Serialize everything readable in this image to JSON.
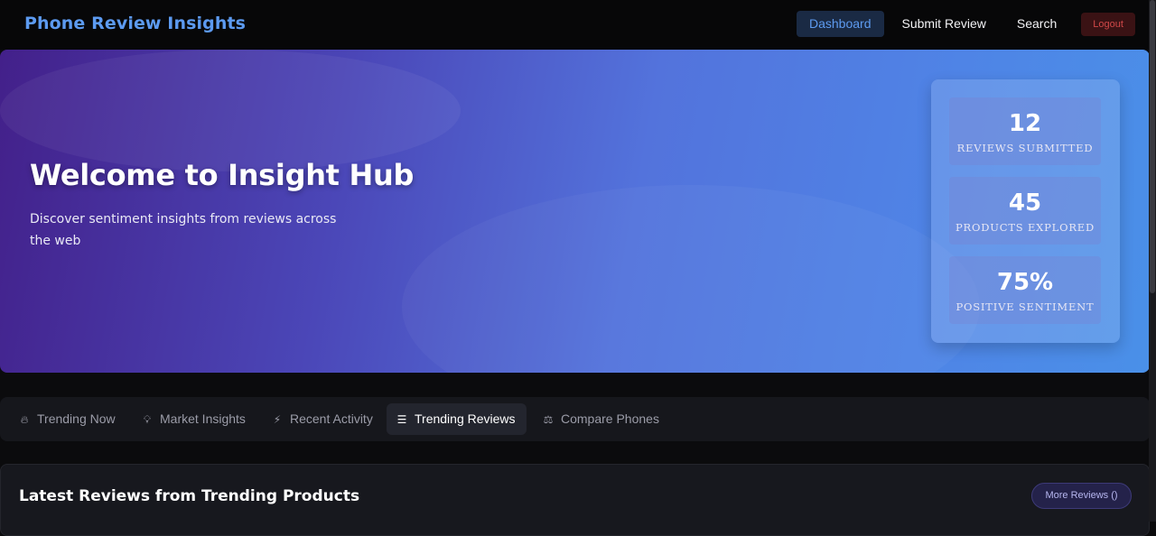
{
  "header": {
    "brand": "Phone Review Insights",
    "nav": {
      "dashboard": "Dashboard",
      "submit_review": "Submit Review",
      "search": "Search",
      "logout": "Logout"
    }
  },
  "hero": {
    "title": "Welcome to Insight Hub",
    "subtitle": "Discover sentiment insights from reviews across the web",
    "stats": [
      {
        "value": "12",
        "label": "REVIEWS SUBMITTED"
      },
      {
        "value": "45",
        "label": "PRODUCTS EXPLORED"
      },
      {
        "value": "75%",
        "label": "POSITIVE SENTIMENT"
      }
    ]
  },
  "tabs": [
    {
      "label": "Trending Now",
      "icon": "fire-icon",
      "glyph": "🔥︎"
    },
    {
      "label": "Market Insights",
      "icon": "lightbulb-icon",
      "glyph": "💡︎"
    },
    {
      "label": "Recent Activity",
      "icon": "bolt-icon",
      "glyph": "⚡︎"
    },
    {
      "label": "Trending Reviews",
      "icon": "list-icon",
      "glyph": "☰",
      "active": true
    },
    {
      "label": "Compare Phones",
      "icon": "scale-icon",
      "glyph": "⚖︎"
    }
  ],
  "section": {
    "title": "Latest Reviews from Trending Products",
    "more_button": "More Reviews ()"
  },
  "colors": {
    "brand": "#5c9af0",
    "nav_active_bg": "#1a2a44",
    "logout_text": "#d04848",
    "hero_gradient_start": "#43208a",
    "hero_gradient_end": "#4a90e8"
  }
}
